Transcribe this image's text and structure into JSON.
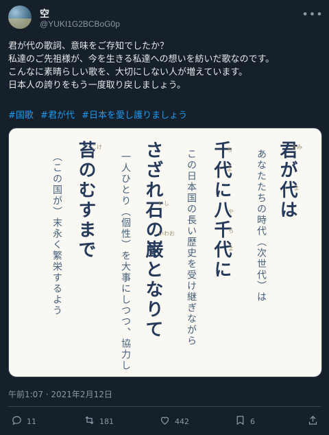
{
  "author": {
    "display_name": "空",
    "handle": "@YUKI1G2BCBoG0p"
  },
  "post": {
    "lines": [
      "君が代の歌詞、意味をご存知でしたか？",
      "私達のご先祖様が、今を生きる私達への想いを紡いだ歌なのです。",
      "こんなに素晴らしい歌を、大切にしない人が増えています。",
      "日本人の誇りをもう一度取り戻しましょう。"
    ],
    "hashtags": [
      "#国歌",
      "#君が代",
      "#日本を愛し護りましょう"
    ]
  },
  "image": {
    "columns": [
      {
        "text": "君が代は",
        "style": "big"
      },
      {
        "text": "あなたたちの時代（次世代）は",
        "style": "small"
      },
      {
        "text": "千代に八千代に",
        "style": "big"
      },
      {
        "text": "この日本国の長い歴史を受け継ぎながら",
        "style": "small"
      },
      {
        "text": "さざれ石の巌となりて",
        "style": "big"
      },
      {
        "text": "一人ひとり（個性）を大事にしつつ、協力し",
        "style": "small"
      },
      {
        "text": "苔のむすまで",
        "style": "big"
      },
      {
        "text": "（この国が）末永く繁栄するよう",
        "style": "small"
      }
    ],
    "ruby": [
      "きみ",
      "よ",
      "ち",
      "よ",
      "や",
      "ち",
      "よ",
      "いし",
      "いわお",
      "こけ"
    ]
  },
  "timestamp": "午前1:07 · 2021年2月12日",
  "metrics": {
    "replies": "11",
    "reposts": "181",
    "likes": "442",
    "bookmarks": "6"
  },
  "colors": {
    "background": "#15202b",
    "link": "#1d9bf0",
    "muted": "#8b98a5"
  }
}
